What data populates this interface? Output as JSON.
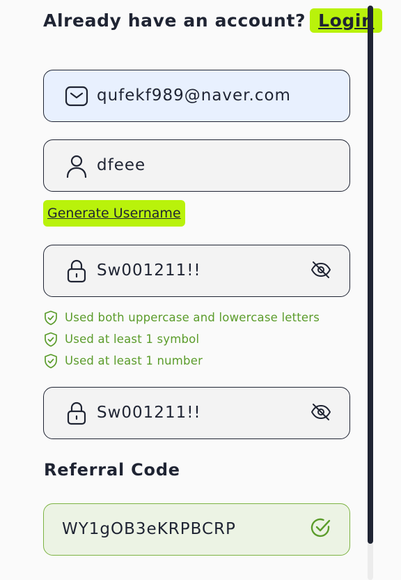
{
  "header": {
    "question": "Already have an account?",
    "login_label": "Login"
  },
  "form": {
    "email": {
      "value": "qufekf989@naver.com",
      "icon": "mail-icon"
    },
    "username": {
      "value": "dfeee",
      "icon": "user-icon"
    },
    "generate_username_label": "Generate Username",
    "password": {
      "value": "Sw001211!!",
      "icon": "lock-icon",
      "toggle_icon": "eye-off-icon"
    },
    "password_rules": [
      "Used both uppercase and lowercase letters",
      "Used at least 1 symbol",
      "Used at least 1 number"
    ],
    "confirm_password": {
      "value": "Sw001211!!",
      "icon": "lock-icon",
      "toggle_icon": "eye-off-icon"
    },
    "referral": {
      "title": "Referral Code",
      "value": "WY1gOB3eKRPBCRP",
      "status_icon": "check-circle-icon"
    }
  },
  "colors": {
    "accent": "#b9f20b",
    "text": "#1f2433",
    "success": "#5b9c2b",
    "email_bg": "#e8f0fe",
    "referral_bg": "#ecf3e4"
  }
}
